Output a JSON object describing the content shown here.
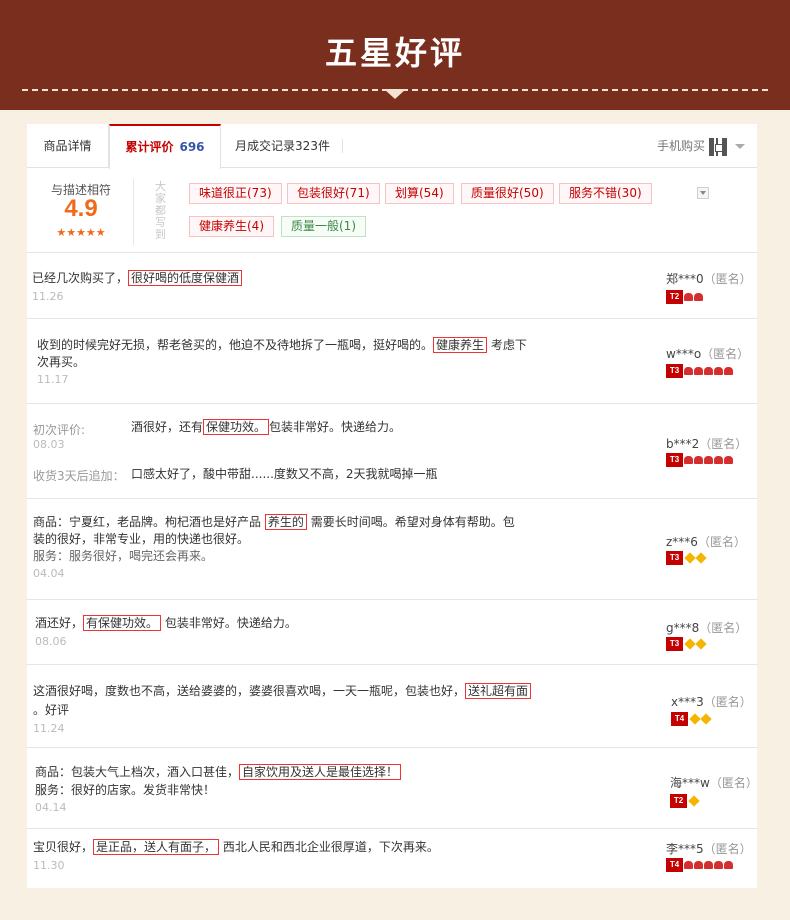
{
  "banner": {
    "title": "五星好评"
  },
  "tabs": {
    "details": "商品详情",
    "reviews_label": "累计评价",
    "reviews_count": "696",
    "sales_label": "月成交记录323件",
    "mobile_label": "手机购买"
  },
  "summary": {
    "score_label": "与描述相符",
    "score": "4.9",
    "stars": "★★★★★",
    "stars_value": 5,
    "hint": "大家都写到",
    "tags": [
      {
        "label": "味道很正(73)",
        "type": "positive"
      },
      {
        "label": "包装很好(71)",
        "type": "positive"
      },
      {
        "label": "划算(54)",
        "type": "positive"
      },
      {
        "label": "质量很好(50)",
        "type": "positive"
      },
      {
        "label": "服务不错(30)",
        "type": "positive"
      },
      {
        "label": "健康养生(4)",
        "type": "positive"
      },
      {
        "label": "质量一般(1)",
        "type": "neutral"
      }
    ]
  },
  "reviews": [
    {
      "pre": "已经几次购买了，",
      "hl": "很好喝的低度保健酒",
      "post": "",
      "date": "11.26",
      "user": "郑***0",
      "anon": "（匿名）",
      "level": "T2",
      "badges": [
        "heart",
        "heart"
      ]
    },
    {
      "pre": "收到的时候完好无损，帮老爸买的，他迫不及待地拆了一瓶喝，挺好喝的。",
      "hl": "健康养生",
      "post": "考虑下",
      "line2": "次再买。",
      "date": "11.17",
      "user": "w***o",
      "anon": "（匿名）",
      "level": "T3",
      "badges": [
        "heart",
        "heart",
        "heart",
        "heart",
        "heart"
      ]
    },
    {
      "initial_label": "初次评价:",
      "pre": "酒很好，还有",
      "hl": "保健功效。",
      "post": "包装非常好。快递给力。",
      "date": "08.03",
      "append_label": "收货3天后追加：",
      "append_text": "口感太好了，酸中带甜......度数又不高，2天我就喝掉一瓶",
      "user": "b***2",
      "anon": "（匿名）",
      "level": "T3",
      "badges": [
        "heart",
        "heart",
        "heart",
        "heart",
        "heart"
      ]
    },
    {
      "pre": "商品：宁夏红，老品牌。枸杞酒也是好产品",
      "hl": "养生的",
      "post": "需要长时间喝。希望对身体有帮助。包",
      "line2": "装的很好，非常专业，用的快递也很好。",
      "line3": "服务：服务很好，喝完还会再来。",
      "date": "04.04",
      "user": "z***6",
      "anon": "（匿名）",
      "level": "T3",
      "badges": [
        "diamond",
        "diamond"
      ]
    },
    {
      "pre": "酒还好，",
      "hl": "有保健功效。",
      "post": "包装非常好。快递给力。",
      "date": "08.06",
      "user": "g***8",
      "anon": "（匿名）",
      "level": "T3",
      "badges": [
        "diamond",
        "diamond"
      ]
    },
    {
      "pre": "这酒很好喝，度数也不高，送给婆婆的，婆婆很喜欢喝，一天一瓶呢，包装也好，",
      "hl": "送礼超有面",
      "post": "",
      "line2": "。好评",
      "date": "11.24",
      "user": "x***3",
      "anon": "（匿名）",
      "level": "T4",
      "badges": [
        "diamond",
        "diamond"
      ]
    },
    {
      "pre": "商品：包装大气上档次，酒入口甚佳，",
      "hl": "自家饮用及送人是最佳选择！",
      "post": "",
      "line2": "服务：很好的店家。发货非常快！",
      "date": "04.14",
      "user": "海***w",
      "anon": "（匿名）",
      "level": "T2",
      "badges": [
        "diamond"
      ]
    },
    {
      "pre": "宝贝很好，",
      "hl": "是正品，送人有面子，",
      "post": "西北人民和西北企业很厚道，下次再来。",
      "date": "11.30",
      "user": "李***5",
      "anon": "（匿名）",
      "level": "T4",
      "badges": [
        "heart",
        "heart",
        "heart",
        "heart",
        "heart"
      ]
    }
  ]
}
